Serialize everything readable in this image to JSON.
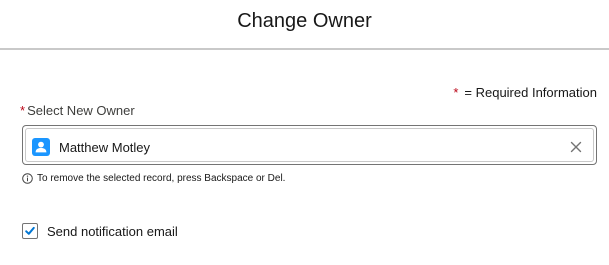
{
  "dialog": {
    "title": "Change Owner"
  },
  "form": {
    "required_marker": "*",
    "required_info": "= Required Information",
    "owner_field": {
      "label": "Select New Owner",
      "selected_value": "Matthew Motley",
      "icon": "user-icon",
      "help_text": "To remove the selected record, press Backspace or Del."
    },
    "notification": {
      "label": "Send notification email",
      "checked": true
    }
  },
  "colors": {
    "required": "#ba0517",
    "brand_blue": "#1b96ff",
    "checkbox_check": "#0176d3"
  }
}
